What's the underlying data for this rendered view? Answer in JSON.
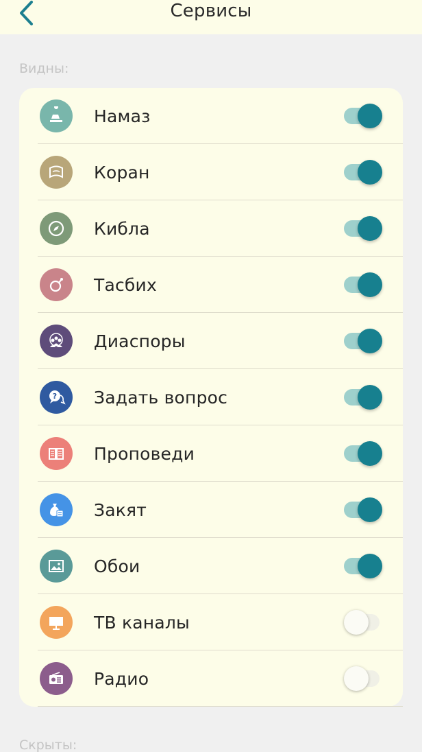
{
  "header": {
    "title": "Сервисы",
    "back_icon": "chevron-left-icon",
    "accent_color": "#1c7f8f"
  },
  "sections": {
    "visible_label": "Видны:",
    "hidden_label": "Скрыты:"
  },
  "items": [
    {
      "label": "Намаз",
      "icon": "prayer-icon",
      "color": "#79b6ab",
      "enabled": true
    },
    {
      "label": "Коран",
      "icon": "quran-icon",
      "color": "#b8a679",
      "enabled": true
    },
    {
      "label": "Кибла",
      "icon": "compass-icon",
      "color": "#7e9a78",
      "enabled": true
    },
    {
      "label": "Тасбих",
      "icon": "tasbih-icon",
      "color": "#c9848a",
      "enabled": true
    },
    {
      "label": "Диаспоры",
      "icon": "community-icon",
      "color": "#5e4c7a",
      "enabled": true
    },
    {
      "label": "Задать вопрос",
      "icon": "question-chat-icon",
      "color": "#2f5aa0",
      "enabled": true
    },
    {
      "label": "Проповеди",
      "icon": "book-icon",
      "color": "#ec8079",
      "enabled": true
    },
    {
      "label": "Закят",
      "icon": "money-bag-icon",
      "color": "#4593e6",
      "enabled": true
    },
    {
      "label": "Обои",
      "icon": "image-icon",
      "color": "#5a9a98",
      "enabled": true
    },
    {
      "label": "ТВ каналы",
      "icon": "tv-icon",
      "color": "#f3a55c",
      "enabled": false
    },
    {
      "label": "Радио",
      "icon": "radio-icon",
      "color": "#8c5d8c",
      "enabled": false
    }
  ]
}
